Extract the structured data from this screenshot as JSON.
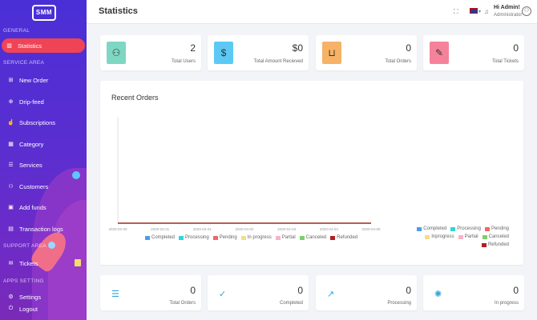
{
  "brand": {
    "logo_text": "SMM"
  },
  "sidebar": {
    "sections": [
      {
        "title": "GENERAL"
      },
      {
        "title": "SERVICE AREA"
      },
      {
        "title": "SUPPORT AREA"
      },
      {
        "title": "APPS SETTING"
      }
    ],
    "items": [
      {
        "label": "Statistics",
        "icon": "bar-chart-icon",
        "glyph": "▥",
        "active": true
      },
      {
        "label": "New Order",
        "icon": "cart-icon",
        "glyph": "⊞"
      },
      {
        "label": "Drip-feed",
        "icon": "droplet-icon",
        "glyph": "⊕"
      },
      {
        "label": "Subscriptions",
        "icon": "thumbs-up-icon",
        "glyph": "☝"
      },
      {
        "label": "Category",
        "icon": "grid-icon",
        "glyph": "▦"
      },
      {
        "label": "Services",
        "icon": "list-icon",
        "glyph": "☰"
      },
      {
        "label": "Customers",
        "icon": "users-icon",
        "glyph": "⚇"
      },
      {
        "label": "Add funds",
        "icon": "wallet-icon",
        "glyph": "▣"
      },
      {
        "label": "Transaction logs",
        "icon": "receipt-icon",
        "glyph": "▤"
      },
      {
        "label": "Tickets",
        "icon": "ticket-icon",
        "glyph": "✉"
      },
      {
        "label": "Settings",
        "icon": "gear-icon",
        "glyph": "⚙"
      },
      {
        "label": "Logout",
        "icon": "power-icon",
        "glyph": "⏻"
      }
    ]
  },
  "topbar": {
    "title": "Statistics",
    "user_greeting": "Hi Admin!",
    "user_role": "Administrator"
  },
  "stats_top": [
    {
      "value": "2",
      "label": "Total Users",
      "icon": "users-icon",
      "glyph": "⚇",
      "color": "#7ed7c2"
    },
    {
      "value": "$0",
      "label": "Total Amount Recieved",
      "icon": "dollar-icon",
      "glyph": "$",
      "color": "#5cc9f5"
    },
    {
      "value": "0",
      "label": "Total Orders",
      "icon": "cart-icon",
      "glyph": "⊔",
      "color": "#f6b266"
    },
    {
      "value": "0",
      "label": "Total Tickets",
      "icon": "ticket-icon",
      "glyph": "✎",
      "color": "#f6829a"
    }
  ],
  "stats_bottom": [
    {
      "value": "0",
      "label": "Total Orders",
      "icon": "list-icon",
      "glyph": "☰",
      "color": "#2fa7d8"
    },
    {
      "value": "0",
      "label": "Completed",
      "icon": "check-icon",
      "glyph": "✓",
      "color": "#2fa7d8"
    },
    {
      "value": "0",
      "label": "Processing",
      "icon": "trend-up-icon",
      "glyph": "↗",
      "color": "#2fa7d8"
    },
    {
      "value": "0",
      "label": "In progress",
      "icon": "spinner-icon",
      "glyph": "✺",
      "color": "#2fa7d8"
    }
  ],
  "chart_data": {
    "type": "line",
    "title": "Recent Orders",
    "x": [
      "2020-03-30",
      "2020-03-31",
      "2020-04-01",
      "2020-04-02",
      "2020-04-03",
      "2020-04-04",
      "2020-04-05"
    ],
    "series": [
      {
        "name": "Completed",
        "color": "#4a9fe8",
        "values": [
          0,
          0,
          0,
          0,
          0,
          0,
          0
        ]
      },
      {
        "name": "Processing",
        "color": "#2fd6d6",
        "values": [
          0,
          0,
          0,
          0,
          0,
          0,
          0
        ]
      },
      {
        "name": "Pending",
        "color": "#f56565",
        "values": [
          0,
          0,
          0,
          0,
          0,
          0,
          0
        ]
      },
      {
        "name": "In progress",
        "color": "#f3dd8a",
        "values": [
          0,
          0,
          0,
          0,
          0,
          0,
          0
        ]
      },
      {
        "name": "Partial",
        "color": "#f6b3c6",
        "values": [
          0,
          0,
          0,
          0,
          0,
          0,
          0
        ]
      },
      {
        "name": "Canceled",
        "color": "#7ad16a",
        "values": [
          0,
          0,
          0,
          0,
          0,
          0,
          0
        ]
      },
      {
        "name": "Refunded",
        "color": "#b21f1f",
        "values": [
          0,
          0,
          0,
          0,
          0,
          0,
          0
        ]
      }
    ],
    "pie_legend": [
      "Completed",
      "Processing",
      "Pending",
      "Inprogress",
      "Partial",
      "Canceled",
      "Refunded"
    ],
    "grid": false,
    "legend_position": "bottom"
  }
}
